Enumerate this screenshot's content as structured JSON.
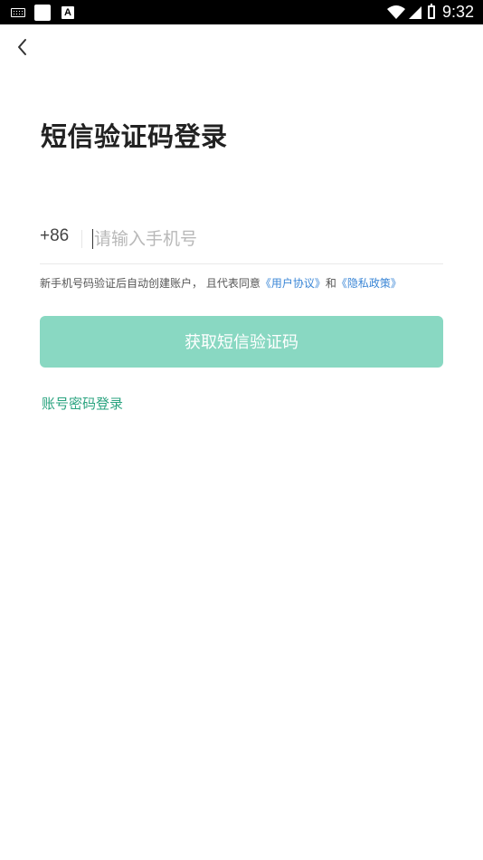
{
  "status_bar": {
    "time": "9:32",
    "icons": [
      "keyboard-icon",
      "notification-square-icon",
      "text-a-icon",
      "wifi-icon",
      "signal-icon",
      "battery-icon"
    ]
  },
  "header": {
    "back_icon": "chevron-left-icon"
  },
  "title": "短信验证码登录",
  "phone": {
    "country_code": "+86",
    "placeholder": "请输入手机号",
    "value": ""
  },
  "agreement": {
    "prefix": "新手机号码验证后自动创建账户， 且代表同意",
    "user_agreement": "《用户协议》",
    "and": "和",
    "privacy_policy": "《隐私政策》"
  },
  "sms_button_label": "获取短信验证码",
  "password_login_label": "账号密码登录",
  "colors": {
    "accent": "#2aa37f",
    "button_bg": "#89d8c2",
    "link": "#3a86d6",
    "title": "#222222"
  }
}
